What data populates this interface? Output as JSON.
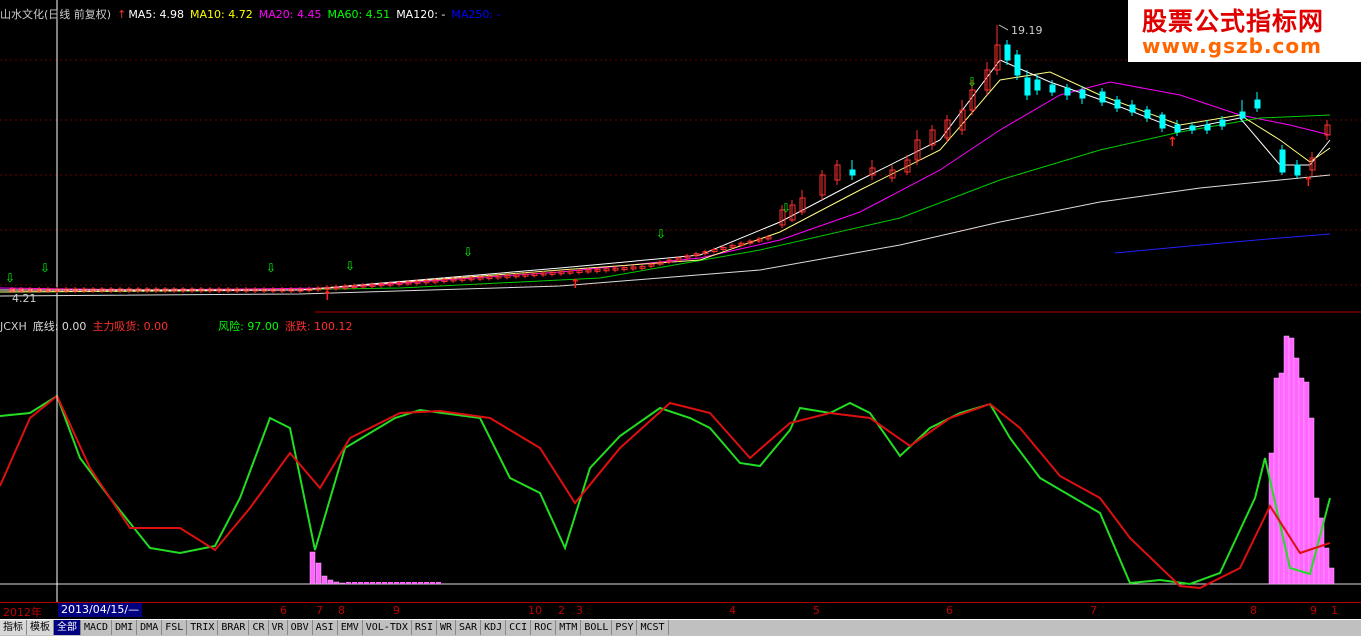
{
  "price_panel": {
    "title": "山水文化(日线 前复权)",
    "ma_items": [
      {
        "label": "MA5: 4.98",
        "color": "#ffffff"
      },
      {
        "label": "MA10: 4.72",
        "color": "#ffff00"
      },
      {
        "label": "MA20: 4.45",
        "color": "#ff00ff"
      },
      {
        "label": "MA60: 4.51",
        "color": "#00ff00"
      },
      {
        "label": "MA120: -",
        "color": "#ffffff"
      },
      {
        "label": "MA250: -",
        "color": "#0000ff"
      }
    ],
    "high_label": "19.19",
    "low_label": "4.21"
  },
  "indicator_panel": {
    "name": "JCXH",
    "items": [
      {
        "label": "底线: 0.00",
        "color": "#dddddd"
      },
      {
        "label": "主力吸货: 0.00",
        "color": "#ff3030"
      },
      {
        "label": "风险: 97.00",
        "color": "#00ff00"
      },
      {
        "label": "涨跌: 100.12",
        "color": "#ff3030"
      }
    ]
  },
  "watermark": {
    "line1": "股票公式指标网",
    "line2": "www.gszb.com"
  },
  "time_axis": {
    "cursor_date": "2013/04/15/—",
    "labels": [
      "2012年",
      "6",
      "7",
      "8",
      "9",
      "10",
      "2",
      "3",
      "4",
      "5",
      "6",
      "7",
      "8",
      "9",
      "1"
    ]
  },
  "tabs": {
    "items": [
      "指标",
      "模板",
      "全部",
      "MACD",
      "DMI",
      "DMA",
      "FSL",
      "TRIX",
      "BRAR",
      "CR",
      "VR",
      "OBV",
      "ASI",
      "EMV",
      "VOL-TDX",
      "RSI",
      "WR",
      "SAR",
      "KDJ",
      "CCI",
      "ROC",
      "MTM",
      "BOLL",
      "PSY",
      "MCST"
    ],
    "active": "全部"
  },
  "colors": {
    "background": "#000000",
    "up": "#ff3030",
    "down": "#00ffff",
    "grid": "#800000"
  }
}
